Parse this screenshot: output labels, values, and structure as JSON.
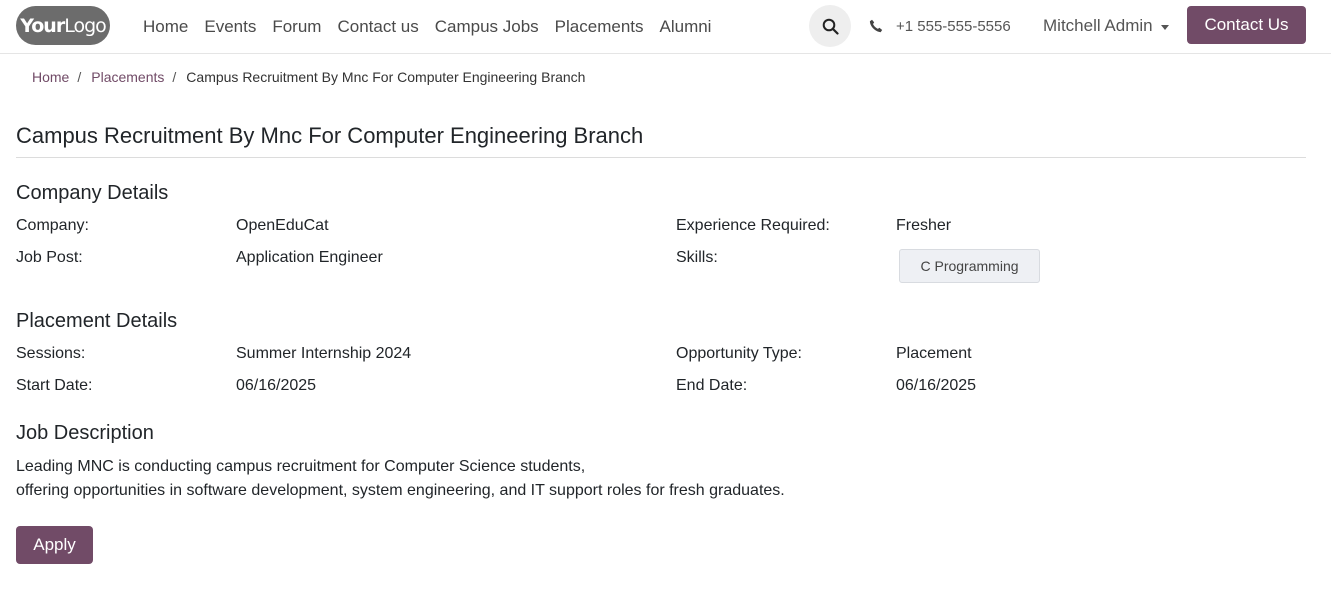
{
  "header": {
    "logo": {
      "part1": "Your",
      "part2": "Logo"
    },
    "nav": [
      "Home",
      "Events",
      "Forum",
      "Contact us",
      "Campus Jobs",
      "Placements",
      "Alumni"
    ],
    "phone": "+1 555-555-5556",
    "user": "Mitchell Admin",
    "cta": "Contact Us",
    "accent_color": "#714b67"
  },
  "breadcrumb": {
    "home": "Home",
    "placements": "Placements",
    "current": "Campus Recruitment By Mnc For Computer Engineering Branch",
    "separator": "/"
  },
  "page": {
    "title": "Campus Recruitment By Mnc For Computer Engineering Branch"
  },
  "company_details": {
    "heading": "Company Details",
    "company_label": "Company:",
    "company_value": "OpenEduCat",
    "experience_label": "Experience Required:",
    "experience_value": "Fresher",
    "job_post_label": "Job Post:",
    "job_post_value": "Application Engineer",
    "skills_label": "Skills:",
    "skills": [
      "C Programming"
    ]
  },
  "placement_details": {
    "heading": "Placement Details",
    "sessions_label": "Sessions:",
    "sessions_value": "Summer Internship 2024",
    "opportunity_label": "Opportunity Type:",
    "opportunity_value": "Placement",
    "start_label": "Start Date:",
    "start_value": "06/16/2025",
    "end_label": "End Date:",
    "end_value": "06/16/2025"
  },
  "job_description": {
    "heading": "Job Description",
    "line1": "Leading MNC is conducting campus recruitment for Computer Science students,",
    "line2": "offering opportunities in software development, system engineering, and IT support roles for fresh graduates."
  },
  "apply_label": "Apply"
}
